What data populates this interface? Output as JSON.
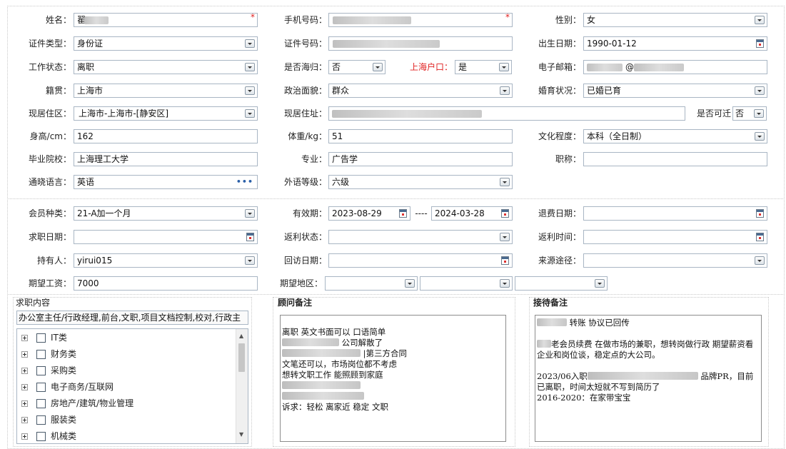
{
  "form": {
    "name": {
      "label": "姓名：",
      "value": "翟"
    },
    "phone": {
      "label": "手机号码："
    },
    "gender": {
      "label": "性别：",
      "value": "女"
    },
    "id_type": {
      "label": "证件类型：",
      "value": "身份证"
    },
    "id_number": {
      "label": "证件号码："
    },
    "birth_date": {
      "label": "出生日期：",
      "value": "1990-01-12"
    },
    "work_status": {
      "label": "工作状态：",
      "value": "离职"
    },
    "returnee": {
      "label": "是否海归：",
      "value": "否"
    },
    "shanghai_hukou": {
      "label": "上海户口：",
      "value": "是"
    },
    "email": {
      "label": "电子邮箱：",
      "value": "@"
    },
    "native_place": {
      "label": "籍贯：",
      "value": "上海市"
    },
    "political_status": {
      "label": "政治面貌：",
      "value": "群众"
    },
    "marital_status": {
      "label": "婚育状况：",
      "value": "已婚已育"
    },
    "residence_area": {
      "label": "现居住区：",
      "value": "上海市-上海市-[静安区]"
    },
    "residence_address": {
      "label": "现居住址："
    },
    "relocatable": {
      "label": "是否可迁",
      "value": "否"
    },
    "height": {
      "label": "身高/cm：",
      "value": "162"
    },
    "weight": {
      "label": "体重/kg：",
      "value": "51"
    },
    "education": {
      "label": "文化程度：",
      "value": "本科（全日制）"
    },
    "school": {
      "label": "毕业院校：",
      "value": "上海理工大学"
    },
    "major": {
      "label": "专业：",
      "value": "广告学"
    },
    "title": {
      "label": "职称：",
      "value": ""
    },
    "language": {
      "label": "通晓语言：",
      "value": "英语"
    },
    "language_level": {
      "label": "外语等级：",
      "value": "六级"
    },
    "member_type": {
      "label": "会员种类：",
      "value": "21-A加一个月"
    },
    "validity": {
      "label": "有效期：",
      "start": "2023-08-29",
      "sep": "----",
      "end": "2024-03-28"
    },
    "refund_date": {
      "label": "退费日期：",
      "value": ""
    },
    "job_seek_date": {
      "label": "求职日期：",
      "value": ""
    },
    "rebate_status": {
      "label": "返利状态：",
      "value": ""
    },
    "rebate_time": {
      "label": "返利时间：",
      "value": ""
    },
    "holder": {
      "label": "持有人：",
      "value": "yirui015"
    },
    "visit_date": {
      "label": "回访日期：",
      "value": ""
    },
    "source": {
      "label": "来源途径：",
      "value": ""
    },
    "expected_salary": {
      "label": "期望工资：",
      "value": "7000"
    },
    "expected_region": {
      "label": "期望地区："
    }
  },
  "job_panel": {
    "title": "求职内容",
    "summary": "办公室主任/行政经理,前台,文职,项目文档控制,校对,行政主",
    "tree_items": [
      "IT类",
      "财务类",
      "采购类",
      "电子商务/互联网",
      "房地产/建筑/物业管理",
      "服装类",
      "机械类"
    ]
  },
  "consultant_panel": {
    "title": "顾问备注",
    "lines": [
      "离职  英文书面可以 口语简单",
      "公司解散了",
      "|第三方合同",
      "文笔还可以，市场岗位都不考虑",
      "想转文职工作 能照顾到家庭",
      "",
      "",
      "诉求：轻松 离家近  稳定  文职"
    ]
  },
  "reception_panel": {
    "title": "接待备注",
    "lines": [
      "转账  协议已回传",
      "老会员续费  在做市场的兼职，想转岗做行政 期望薪资看企业和岗位谈，稳定点的大公司。",
      "2023/06入职",
      "品牌PR，目前已离职，时间太短就不写到简历了",
      "2016-2020：在家带宝宝"
    ]
  },
  "icons": {
    "dropdown": "chevron-down-icon",
    "calendar": "calendar-icon",
    "more": "ellipsis-icon",
    "required": "asterisk-icon"
  },
  "colors": {
    "required": "#e02020",
    "label_highlight": "#e02020",
    "field_border": "#a9b6c4"
  }
}
